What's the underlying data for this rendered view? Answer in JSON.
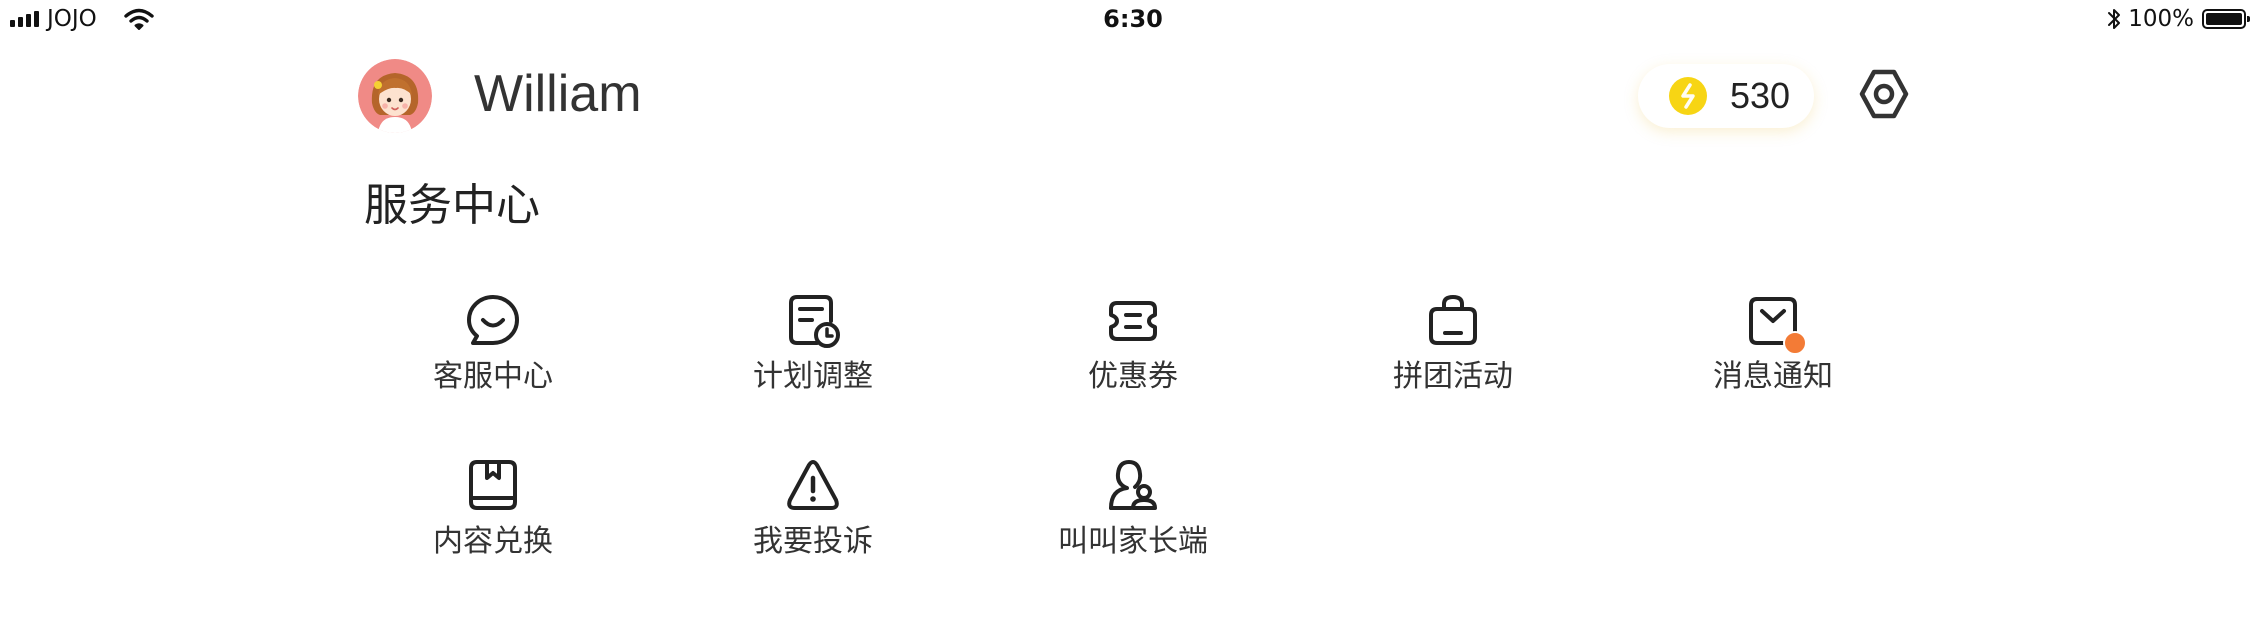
{
  "status_bar": {
    "carrier": "JOJO",
    "time": "6:30",
    "battery_percent": "100%",
    "battery_level": 1.0
  },
  "header": {
    "username": "William",
    "coin_count": "530",
    "avatar_icon": "girl-avatar-icon",
    "coin_icon": "coin-icon",
    "settings_icon": "hexagon-settings-icon"
  },
  "service_center": {
    "title": "服务中心",
    "items": [
      {
        "label": "客服中心",
        "icon": "chat-bubble-smile-icon"
      },
      {
        "label": "计划调整",
        "icon": "plan-clock-icon"
      },
      {
        "label": "优惠券",
        "icon": "coupon-ticket-icon"
      },
      {
        "label": "拼团活动",
        "icon": "shopping-bag-icon"
      },
      {
        "label": "消息通知",
        "icon": "message-envelope-icon",
        "has_badge": true
      },
      {
        "label": "内容兑换",
        "icon": "book-exchange-icon"
      },
      {
        "label": "我要投诉",
        "icon": "warning-triangle-icon"
      },
      {
        "label": "叫叫家长端",
        "icon": "parents-users-icon"
      }
    ]
  },
  "colors": {
    "text_primary": "#222222",
    "text_secondary": "#333333",
    "coin_yellow": "#f7d514",
    "badge_orange": "#f37b36",
    "avatar_bg": "#f08a86"
  }
}
